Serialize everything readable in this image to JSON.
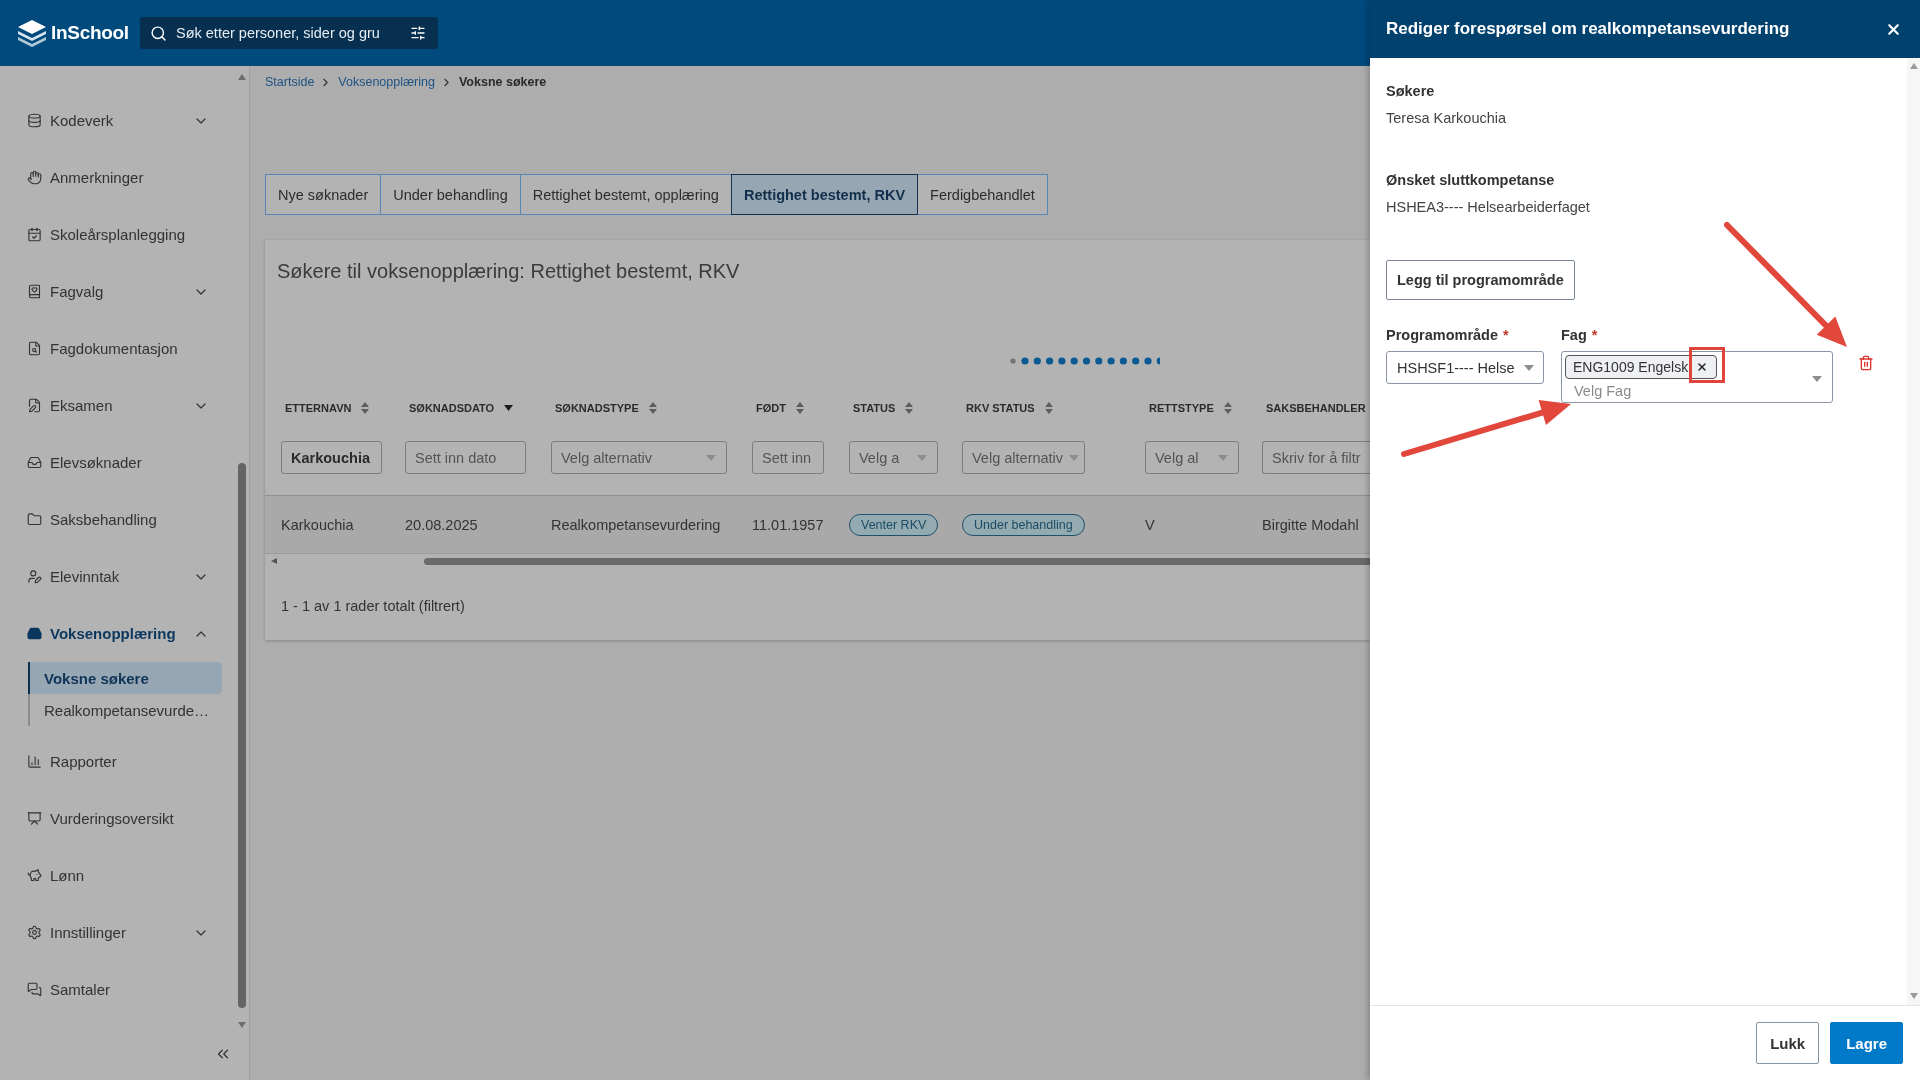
{
  "topbar": {
    "logo": "InSchool",
    "search": {
      "placeholder": "Søk etter personer, sider og gru"
    }
  },
  "sidebar": {
    "items": [
      {
        "label": "Kodeverk",
        "kind": "group",
        "expanded": false,
        "selected": false
      },
      {
        "label": "Anmerkninger",
        "kind": "link",
        "selected": false
      },
      {
        "label": "Skoleårsplanlegging",
        "kind": "link",
        "selected": false
      },
      {
        "label": "Fagvalg",
        "kind": "group",
        "expanded": false,
        "selected": false
      },
      {
        "label": "Fagdokumentasjon",
        "kind": "link",
        "selected": false
      },
      {
        "label": "Eksamen",
        "kind": "group",
        "expanded": false,
        "selected": false
      },
      {
        "label": "Elevsøknader",
        "kind": "link",
        "selected": false
      },
      {
        "label": "Saksbehandling",
        "kind": "link",
        "selected": false
      },
      {
        "label": "Elevinntak",
        "kind": "group",
        "expanded": false,
        "selected": false
      },
      {
        "label": "Voksenopplæring",
        "kind": "group",
        "expanded": true,
        "selected": true,
        "children": [
          {
            "label": "Voksne søkere",
            "selected": true
          },
          {
            "label": "Realkompetansevurde…",
            "selected": false
          }
        ]
      },
      {
        "label": "Rapporter",
        "kind": "link",
        "selected": false
      },
      {
        "label": "Vurderingsoversikt",
        "kind": "link",
        "selected": false
      },
      {
        "label": "Lønn",
        "kind": "link",
        "selected": false
      },
      {
        "label": "Innstillinger",
        "kind": "group",
        "expanded": false,
        "selected": false
      },
      {
        "label": "Samtaler",
        "kind": "link",
        "selected": false
      }
    ]
  },
  "breadcrumb": [
    {
      "label": "Startside",
      "current": false
    },
    {
      "label": "Voksenopplæring",
      "current": false
    },
    {
      "label": "Voksne søkere",
      "current": true
    }
  ],
  "tabs": [
    {
      "label": "Nye søknader",
      "selected": false
    },
    {
      "label": "Under behandling",
      "selected": false
    },
    {
      "label": "Rettighet bestemt, opplæring",
      "selected": false
    },
    {
      "label": "Rettighet bestemt, RKV",
      "selected": true
    },
    {
      "label": "Ferdigbehandlet",
      "selected": false
    }
  ],
  "applicants": {
    "title": "Søkere til voksenopplæring: Rettighet bestemt, RKV",
    "table": {
      "columns": [
        {
          "label": "ETTERNAVN",
          "sorted": false,
          "filter": {
            "kind": "text",
            "value": "Karkouchia"
          }
        },
        {
          "label": "SØKNADSDATO",
          "sorted": true,
          "filter": {
            "kind": "text",
            "placeholder": "Sett inn dato"
          }
        },
        {
          "label": "SØKNADSTYPE",
          "sorted": false,
          "filter": {
            "kind": "select",
            "placeholder": "Velg alternativ"
          }
        },
        {
          "label": "FØDT",
          "sorted": false,
          "filter": {
            "kind": "text",
            "placeholder": "Sett inn"
          }
        },
        {
          "label": "STATUS",
          "sorted": false,
          "filter": {
            "kind": "select",
            "placeholder": "Velg a"
          }
        },
        {
          "label": "RKV STATUS",
          "sorted": false,
          "filter": {
            "kind": "select",
            "placeholder": "Velg alternativ"
          }
        },
        {
          "label": "RETTSTYPE",
          "sorted": false,
          "filter": {
            "kind": "select",
            "placeholder": "Velg al"
          }
        },
        {
          "label": "SAKSBEHANDLER",
          "filter": {
            "kind": "text",
            "placeholder": "Skriv for å filtr"
          }
        }
      ],
      "rows": [
        {
          "cells": [
            {
              "kind": "text",
              "text": "Karkouchia"
            },
            {
              "kind": "text",
              "text": "20.08.2025"
            },
            {
              "kind": "text",
              "text": "Realkompetansevurdering"
            },
            {
              "kind": "text",
              "text": "11.01.1957"
            },
            {
              "kind": "badge",
              "text": "Venter RKV"
            },
            {
              "kind": "badge",
              "text": "Under behandling"
            },
            {
              "kind": "text",
              "text": "V"
            },
            {
              "kind": "text",
              "text": "Birgitte Modahl"
            }
          ]
        }
      ]
    },
    "footer": "1 - 1 av 1 rader totalt (filtrert)"
  },
  "panel": {
    "title": "Rediger forespørsel om realkompetansevurdering",
    "details": [
      {
        "label": "Søkere",
        "value": "Teresa Karkouchia"
      },
      {
        "label": "Ønsket sluttkompetanse",
        "value": "HSHEA3---- Helsearbeiderfaget"
      }
    ],
    "add_button": "Legg til programområde",
    "program_area": {
      "label": "Programområde",
      "required_mark": "*",
      "value": "HSHSF1---- Helse"
    },
    "subjects": {
      "label": "Fag",
      "required_mark": "*",
      "chips": [
        "ENG1009 Engelsk"
      ],
      "placeholder": "Velg Fag"
    },
    "buttons": [
      {
        "label": "Lukk",
        "kind": "secondary"
      },
      {
        "label": "Lagre",
        "kind": "primary"
      }
    ]
  }
}
